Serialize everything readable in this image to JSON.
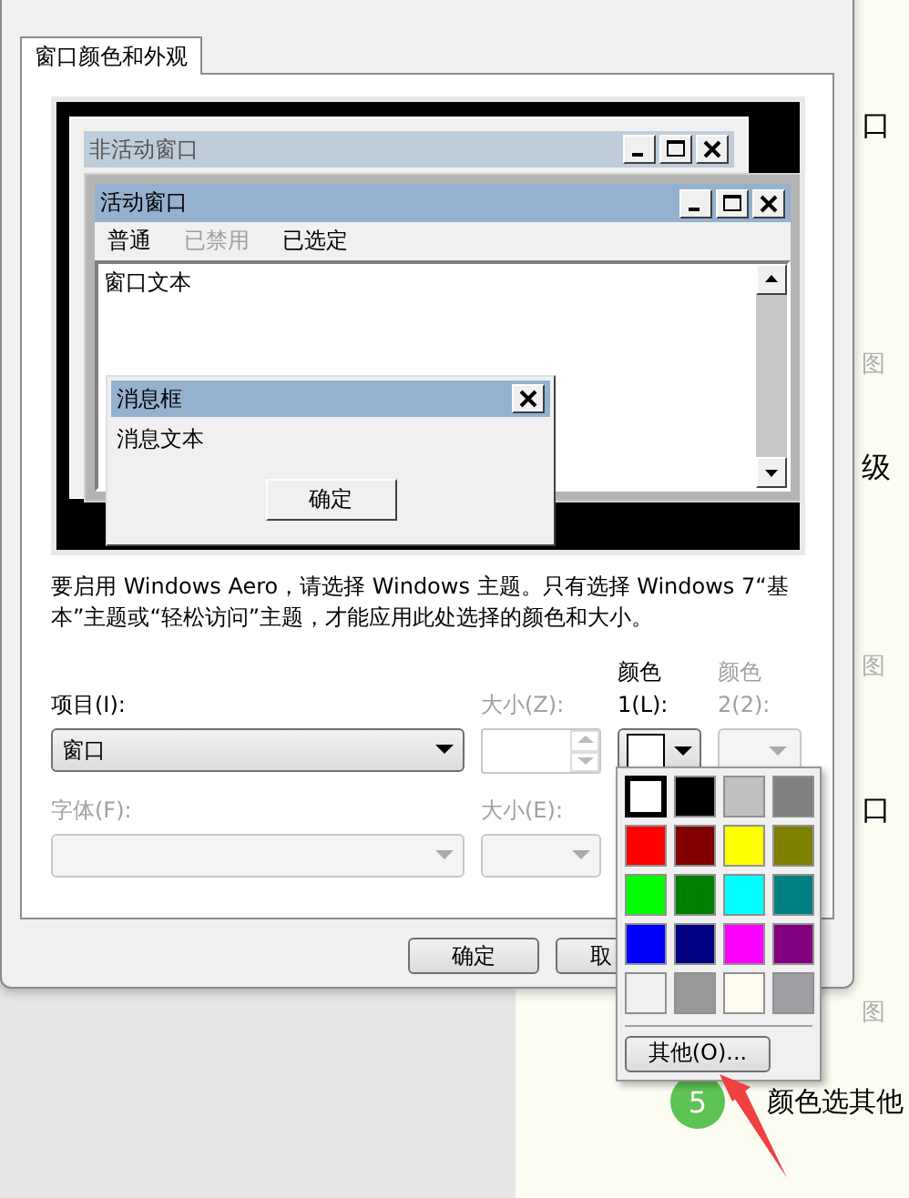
{
  "tabs": [
    {
      "label": "窗口颜色和外观",
      "selected": true
    }
  ],
  "preview": {
    "inactive_window": {
      "title": "非活动窗口"
    },
    "active_window": {
      "title": "活动窗口",
      "menu": [
        {
          "label": "普通",
          "disabled": false
        },
        {
          "label": "已禁用",
          "disabled": true
        },
        {
          "label": "已选定",
          "disabled": false
        }
      ],
      "window_text": "窗口文本"
    },
    "message_box": {
      "title": "消息框",
      "text": "消息文本",
      "button": "确定"
    }
  },
  "description": "要启用 Windows Aero，请选择 Windows 主题。只有选择 Windows 7“基本”主题或“轻松访问”主题，才能应用此处选择的颜色和大小。",
  "item": {
    "label": "项目(I):",
    "value": "窗口",
    "disabled": false
  },
  "item_size": {
    "label": "大小(Z):",
    "disabled": true
  },
  "color_1": {
    "label": "颜色 1(L):",
    "disabled": false,
    "color": "#ffffff"
  },
  "color_2": {
    "label": "颜色 2(2):",
    "disabled": true
  },
  "font": {
    "label": "字体(F):",
    "disabled": true
  },
  "font_size": {
    "label": "大小(E):",
    "disabled": true
  },
  "buttons": [
    {
      "label": "确定"
    },
    {
      "label": "取"
    }
  ],
  "color_menu": {
    "swatches": [
      {
        "color": "#ffffff",
        "selected": true
      },
      {
        "color": "#000000",
        "selected": false
      },
      {
        "color": "#c0c0c0",
        "selected": false
      },
      {
        "color": "#808080",
        "selected": false
      },
      {
        "color": "#ff0000",
        "selected": false
      },
      {
        "color": "#800000",
        "selected": false
      },
      {
        "color": "#ffff00",
        "selected": false
      },
      {
        "color": "#808000",
        "selected": false
      },
      {
        "color": "#00ff00",
        "selected": false
      },
      {
        "color": "#008000",
        "selected": false
      },
      {
        "color": "#00ffff",
        "selected": false
      },
      {
        "color": "#008080",
        "selected": false
      },
      {
        "color": "#0000ff",
        "selected": false
      },
      {
        "color": "#000080",
        "selected": false
      },
      {
        "color": "#ff00ff",
        "selected": false
      },
      {
        "color": "#800080",
        "selected": false
      },
      {
        "color": "#f0f0f0",
        "selected": false
      },
      {
        "color": "#999999",
        "selected": false
      },
      {
        "color": "#fffbf0",
        "selected": false
      },
      {
        "color": "#a0a0a4",
        "selected": false
      }
    ],
    "other_button": "其他(O)..."
  },
  "background_page": {
    "side_texts": [
      {
        "text": "口",
        "kind": "heading"
      },
      {
        "text": "图",
        "kind": "faint"
      },
      {
        "text": "级",
        "kind": "heading"
      },
      {
        "text": "图",
        "kind": "faint"
      },
      {
        "text": "口",
        "kind": "heading"
      },
      {
        "text": "图",
        "kind": "faint"
      }
    ],
    "step": {
      "number": "5",
      "text": "颜色选其他"
    }
  }
}
